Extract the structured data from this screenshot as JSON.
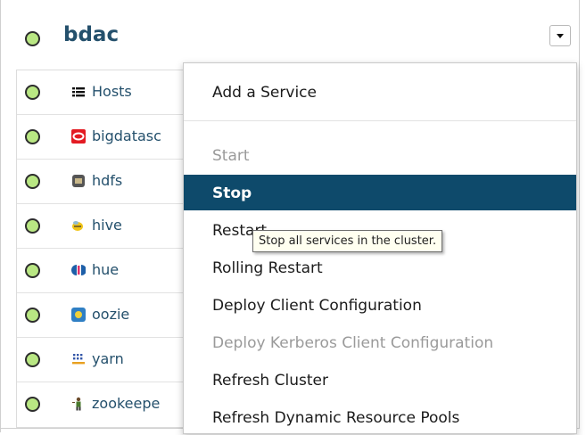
{
  "cluster": {
    "name": "bdac",
    "status_color": "#b9e783"
  },
  "services": [
    {
      "label": "Hosts",
      "icon": "hosts-list-icon"
    },
    {
      "label": "bigdatasc",
      "icon": "oracle-bigdata-icon"
    },
    {
      "label": "hdfs",
      "icon": "hdfs-icon"
    },
    {
      "label": "hive",
      "icon": "hive-bee-icon"
    },
    {
      "label": "hue",
      "icon": "hue-icon"
    },
    {
      "label": "oozie",
      "icon": "oozie-icon"
    },
    {
      "label": "yarn",
      "icon": "yarn-icon"
    },
    {
      "label": "zookeepe",
      "icon": "zookeeper-icon"
    }
  ],
  "menu": {
    "items": [
      {
        "label": "Add a Service",
        "state": "normal"
      },
      {
        "label": "Start",
        "state": "disabled"
      },
      {
        "label": "Stop",
        "state": "active"
      },
      {
        "label": "Restart",
        "state": "normal"
      },
      {
        "label": "Rolling Restart",
        "state": "normal"
      },
      {
        "label": "Deploy Client Configuration",
        "state": "normal"
      },
      {
        "label": "Deploy Kerberos Client Configuration",
        "state": "disabled"
      },
      {
        "label": "Refresh Cluster",
        "state": "normal"
      },
      {
        "label": "Refresh Dynamic Resource Pools",
        "state": "normal"
      }
    ]
  },
  "tooltip": "Stop all services in the cluster.",
  "colors": {
    "accent": "#0e4a6b",
    "link": "#24506c"
  }
}
